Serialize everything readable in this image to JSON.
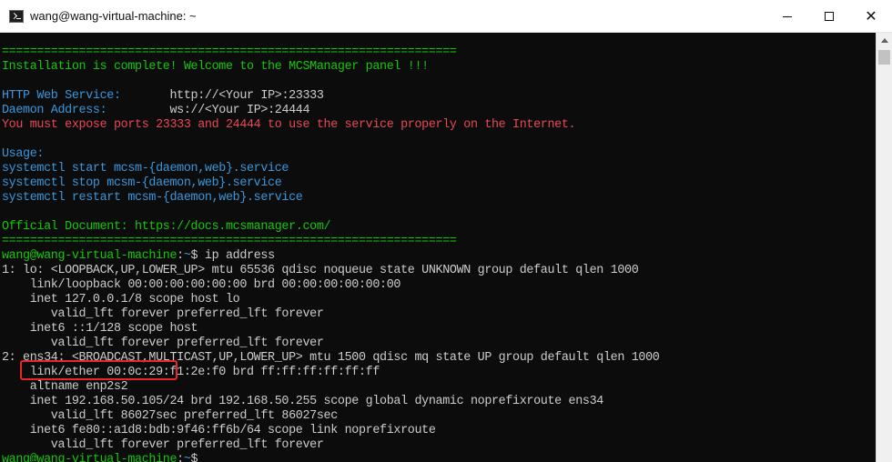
{
  "window": {
    "title": "wang@wang-virtual-machine: ~",
    "icon": "terminal-app-icon",
    "controls": {
      "minimize": "minimize-icon",
      "maximize": "maximize-icon",
      "close": "✕"
    }
  },
  "terminal": {
    "lines": [
      {
        "segments": [
          {
            "text": "=================================================================",
            "color": "green"
          }
        ]
      },
      {
        "segments": [
          {
            "text": "Installation is complete! Welcome to the MCSManager panel !!!",
            "color": "green"
          }
        ]
      },
      {
        "segments": [
          {
            "text": "",
            "color": "white"
          }
        ]
      },
      {
        "segments": [
          {
            "text": "HTTP Web Service:       ",
            "color": "cyan"
          },
          {
            "text": "http://<Your IP>:23333",
            "color": "white"
          }
        ]
      },
      {
        "segments": [
          {
            "text": "Daemon Address:         ",
            "color": "cyan"
          },
          {
            "text": "ws://<Your IP>:24444",
            "color": "white"
          }
        ]
      },
      {
        "segments": [
          {
            "text": "You must expose ports 23333 and 24444 to use the service properly on the Internet.",
            "color": "red"
          }
        ]
      },
      {
        "segments": [
          {
            "text": "",
            "color": "white"
          }
        ]
      },
      {
        "segments": [
          {
            "text": "Usage:",
            "color": "cyan"
          }
        ]
      },
      {
        "segments": [
          {
            "text": "systemctl start mcsm-{daemon,web}.service",
            "color": "cyan"
          }
        ]
      },
      {
        "segments": [
          {
            "text": "systemctl stop mcsm-{daemon,web}.service",
            "color": "cyan"
          }
        ]
      },
      {
        "segments": [
          {
            "text": "systemctl restart mcsm-{daemon,web}.service",
            "color": "cyan"
          }
        ]
      },
      {
        "segments": [
          {
            "text": "",
            "color": "white"
          }
        ]
      },
      {
        "segments": [
          {
            "text": "Official Document: https://docs.mcsmanager.com/",
            "color": "green"
          }
        ]
      },
      {
        "segments": [
          {
            "text": "=================================================================",
            "color": "green"
          }
        ]
      },
      {
        "segments": [
          {
            "text": "wang@wang-virtual-machine",
            "color": "green"
          },
          {
            "text": ":",
            "color": "white"
          },
          {
            "text": "~",
            "color": "cyan"
          },
          {
            "text": "$ ip address",
            "color": "white"
          }
        ]
      },
      {
        "segments": [
          {
            "text": "1: lo: <LOOPBACK,UP,LOWER_UP> mtu 65536 qdisc noqueue state UNKNOWN group default qlen 1000",
            "color": "white"
          }
        ]
      },
      {
        "segments": [
          {
            "text": "    link/loopback 00:00:00:00:00:00 brd 00:00:00:00:00:00",
            "color": "white"
          }
        ]
      },
      {
        "segments": [
          {
            "text": "    inet 127.0.0.1/8 scope host lo",
            "color": "white"
          }
        ]
      },
      {
        "segments": [
          {
            "text": "       valid_lft forever preferred_lft forever",
            "color": "white"
          }
        ]
      },
      {
        "segments": [
          {
            "text": "    inet6 ::1/128 scope host",
            "color": "white"
          }
        ]
      },
      {
        "segments": [
          {
            "text": "       valid_lft forever preferred_lft forever",
            "color": "white"
          }
        ]
      },
      {
        "segments": [
          {
            "text": "2: ens34: <BROADCAST,MULTICAST,UP,LOWER_UP> mtu 1500 qdisc mq state UP group default qlen 1000",
            "color": "white"
          }
        ]
      },
      {
        "segments": [
          {
            "text": "    link/ether 00:0c:29:f1:2e:f0 brd ff:ff:ff:ff:ff:ff",
            "color": "white"
          }
        ]
      },
      {
        "segments": [
          {
            "text": "    altname enp2s2",
            "color": "white"
          }
        ]
      },
      {
        "segments": [
          {
            "text": "    inet 192.168.50.105/24 brd 192.168.50.255 scope global dynamic noprefixroute ens34",
            "color": "white"
          }
        ]
      },
      {
        "segments": [
          {
            "text": "       valid_lft 86027sec preferred_lft 86027sec",
            "color": "white"
          }
        ]
      },
      {
        "segments": [
          {
            "text": "    inet6 fe80::a1d8:bdb:9f46:ff6b/64 scope link noprefixroute",
            "color": "white"
          }
        ]
      },
      {
        "segments": [
          {
            "text": "       valid_lft forever preferred_lft forever",
            "color": "white"
          }
        ]
      },
      {
        "segments": [
          {
            "text": "wang@wang-virtual-machine",
            "color": "green"
          },
          {
            "text": ":",
            "color": "white"
          },
          {
            "text": "~",
            "color": "cyan"
          },
          {
            "text": "$ ",
            "color": "white"
          }
        ]
      }
    ],
    "highlight": {
      "label": "inet 192.168.50.105/",
      "color": "#e8262b"
    }
  },
  "colors": {
    "green": "#16c60c",
    "red": "#e74856",
    "cyan": "#3a96dd",
    "white": "#cccccc",
    "background": "#0c0c0c"
  }
}
